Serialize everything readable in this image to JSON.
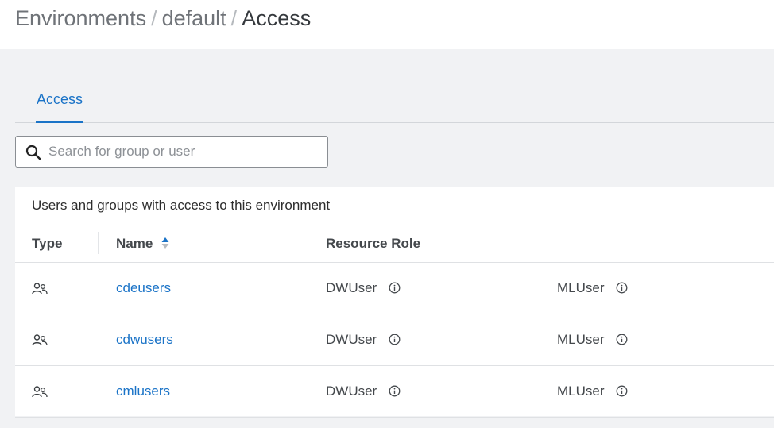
{
  "breadcrumb": {
    "items": [
      "Environments",
      "default"
    ],
    "separator": "/",
    "current": "Access"
  },
  "tabs": [
    {
      "label": "Access",
      "active": true
    }
  ],
  "search": {
    "placeholder": "Search for group or user",
    "value": ""
  },
  "panel": {
    "title": "Users and groups with access to this environment"
  },
  "table": {
    "columns": {
      "type": "Type",
      "name": "Name",
      "resource_role": "Resource Role"
    },
    "sort": {
      "column": "Name",
      "direction": "ascending"
    },
    "rows": [
      {
        "type_icon": "group-icon",
        "name": "cdeusers",
        "role1": "DWUser",
        "role2": "MLUser"
      },
      {
        "type_icon": "group-icon",
        "name": "cdwusers",
        "role1": "DWUser",
        "role2": "MLUser"
      },
      {
        "type_icon": "group-icon",
        "name": "cmlusers",
        "role1": "DWUser",
        "role2": "MLUser"
      }
    ]
  },
  "colors": {
    "accent": "#1a73c7",
    "background": "#f1f2f4",
    "panel": "#ffffff"
  }
}
